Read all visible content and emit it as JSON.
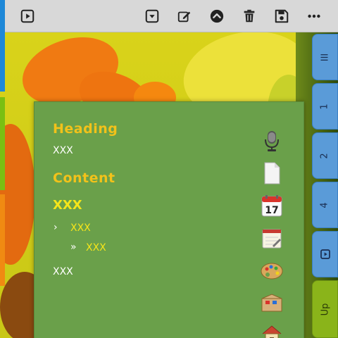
{
  "toolbar": {
    "buttons": [
      {
        "name": "play-box-button",
        "icon": "play-box-icon"
      },
      {
        "name": "dropdown-box-button",
        "icon": "dropdown-box-icon"
      },
      {
        "name": "edit-button",
        "icon": "edit-icon"
      },
      {
        "name": "collapse-up-button",
        "icon": "chevron-up-circle-icon"
      },
      {
        "name": "delete-button",
        "icon": "trash-icon"
      },
      {
        "name": "save-button",
        "icon": "floppy-disk-icon"
      },
      {
        "name": "more-button",
        "icon": "more-horizontal-icon"
      }
    ]
  },
  "right_tabs": [
    {
      "label": "III"
    },
    {
      "label": "1"
    },
    {
      "label": "2"
    },
    {
      "label": "4"
    },
    {
      "label": ""
    },
    {
      "label": "Up"
    }
  ],
  "panel": {
    "heading": "Heading",
    "line1": "XXX",
    "content_heading": "Content",
    "content_title": "XXX",
    "item_level1": "XXX",
    "item_level2": "XXX",
    "footer_line": "XXX",
    "icons": [
      "microphone-icon",
      "document-icon",
      "calendar-icon",
      "notepad-icon",
      "palette-icon",
      "box-icon",
      "home-icon"
    ],
    "calendar_day": "17"
  },
  "colors": {
    "toolbar_bg": "#d8d8d8",
    "panel_bg": "#6aa04a",
    "heading_yellow": "#f2c21a",
    "tab_blue": "#5a9bd8",
    "tab_green": "#8ab41a"
  }
}
